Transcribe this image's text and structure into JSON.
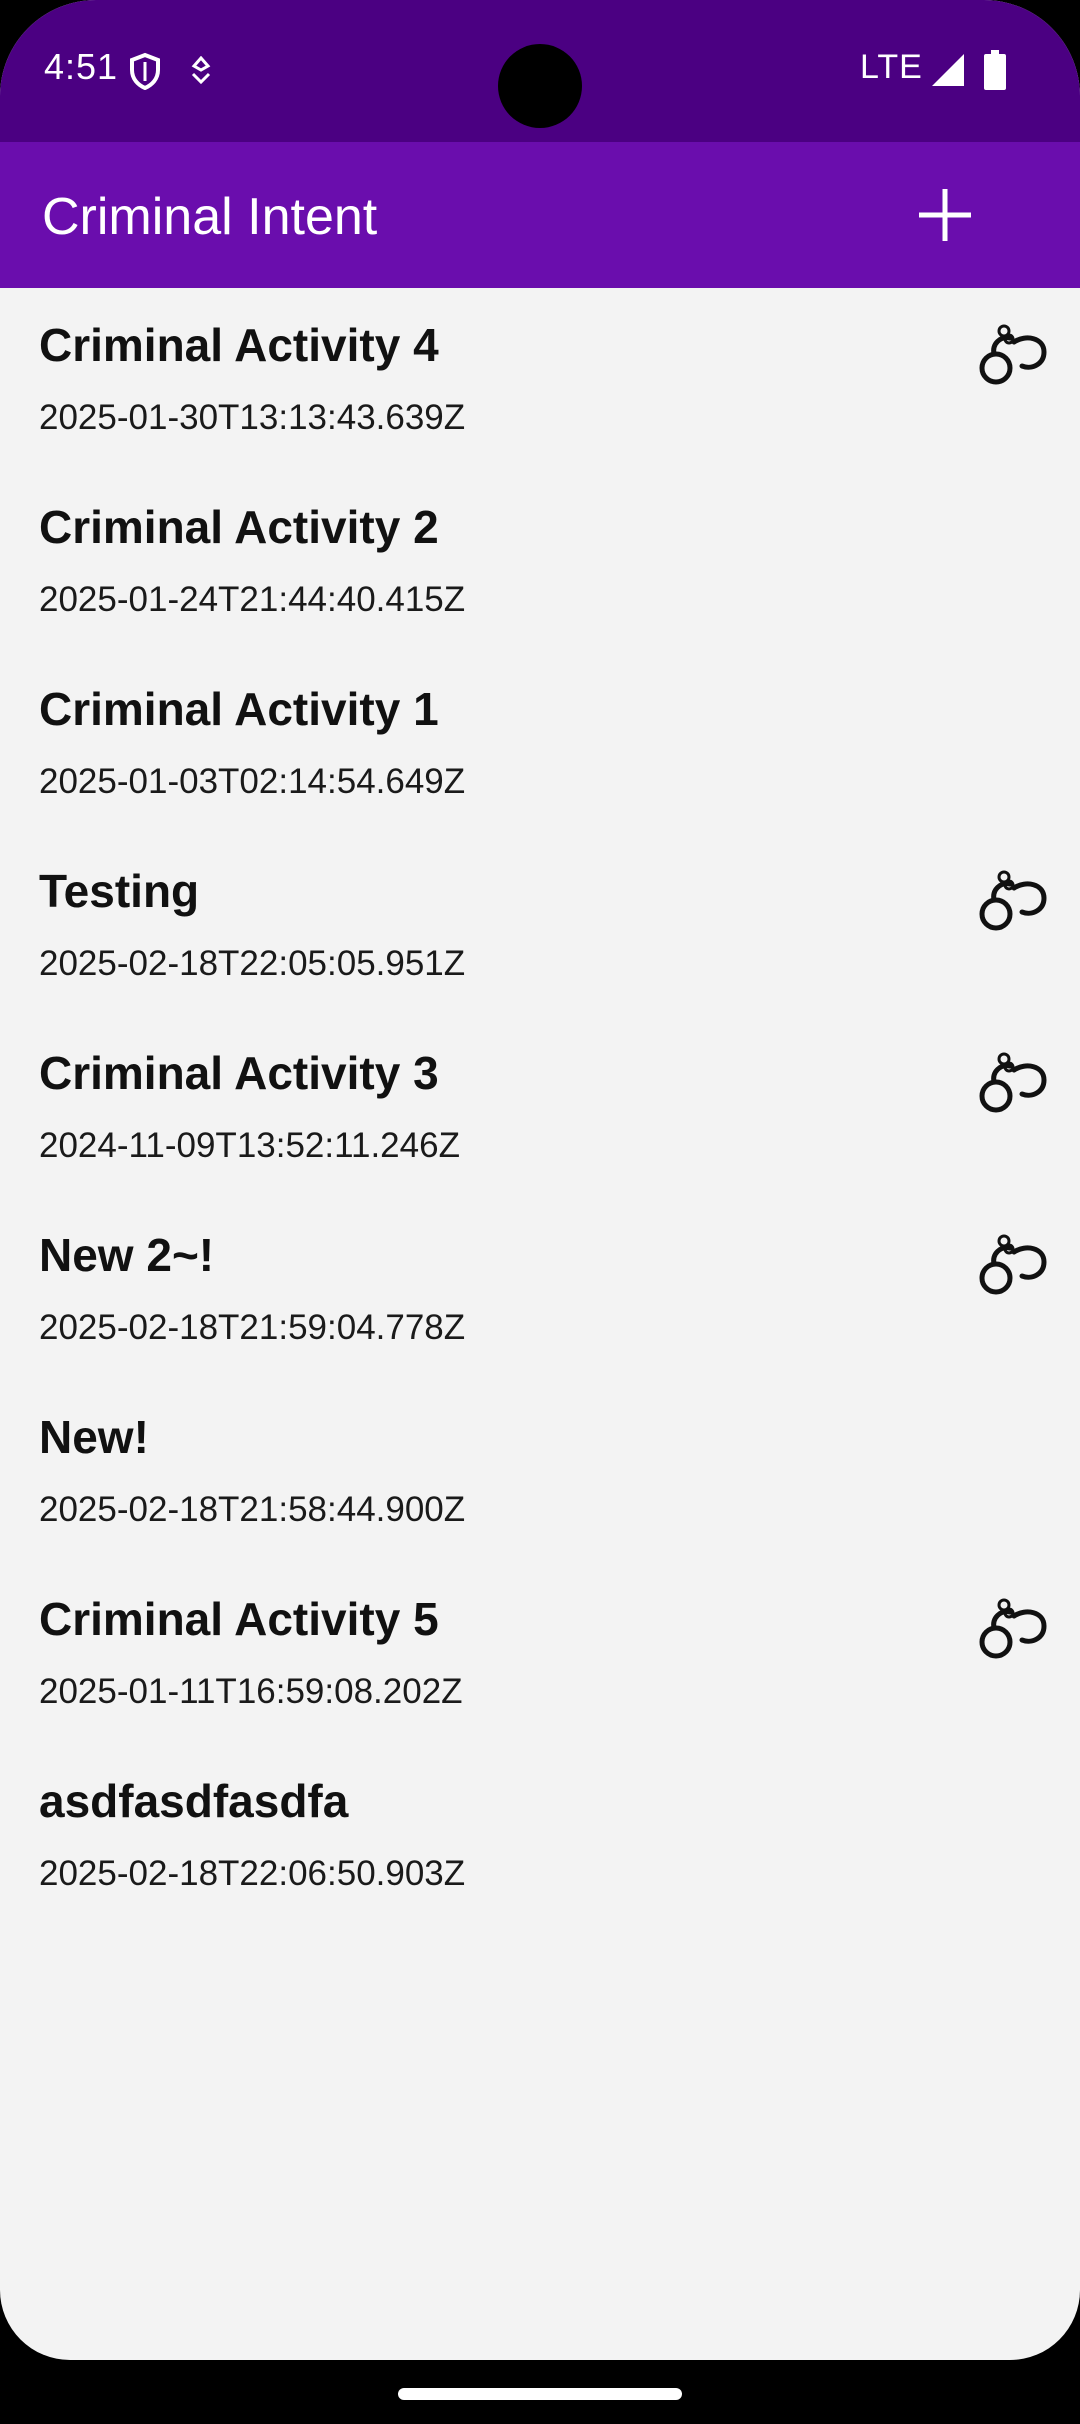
{
  "status_bar": {
    "time": "4:51",
    "network": "LTE",
    "icons": [
      "shield-icon",
      "navigation-icon",
      "signal-icon",
      "battery-icon"
    ]
  },
  "app_bar": {
    "title": "Criminal Intent",
    "add_icon": "plus-icon"
  },
  "colors": {
    "status_bar": "#4b0082",
    "app_bar": "#6a0dad",
    "background": "#f3f3f3"
  },
  "crimes": [
    {
      "title": "Criminal Activity 4",
      "date": "2025-01-30T13:13:43.639Z",
      "solved": true
    },
    {
      "title": "Criminal Activity 2",
      "date": "2025-01-24T21:44:40.415Z",
      "solved": false
    },
    {
      "title": "Criminal Activity 1",
      "date": "2025-01-03T02:14:54.649Z",
      "solved": false
    },
    {
      "title": "Testing",
      "date": "2025-02-18T22:05:05.951Z",
      "solved": true
    },
    {
      "title": "Criminal Activity 3",
      "date": "2024-11-09T13:52:11.246Z",
      "solved": true
    },
    {
      "title": "New 2~!",
      "date": "2025-02-18T21:59:04.778Z",
      "solved": true
    },
    {
      "title": "New!",
      "date": "2025-02-18T21:58:44.900Z",
      "solved": false
    },
    {
      "title": "Criminal Activity 5",
      "date": "2025-01-11T16:59:08.202Z",
      "solved": true
    },
    {
      "title": "asdfasdfasdfa",
      "date": "2025-02-18T22:06:50.903Z",
      "solved": false
    }
  ]
}
